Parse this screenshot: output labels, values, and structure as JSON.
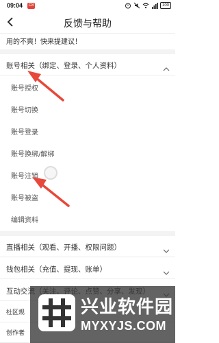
{
  "status_bar": {
    "time": "09:04",
    "badge": "C8",
    "battery": "100"
  },
  "nav": {
    "title": "反馈与帮助"
  },
  "partial_top": {
    "text": "用的不爽！快来提建议！"
  },
  "account_section": {
    "header": "账号相关（绑定、登录、个人资料）",
    "items": [
      "账号授权",
      "账号切换",
      "账号登录",
      "账号换绑/解绑",
      "账号注销",
      "账号被盗",
      "编辑资料"
    ]
  },
  "other_sections": [
    {
      "label": "直播相关（观看、开播、权限问题）"
    },
    {
      "label": "钱包相关（充值、提现、账单）"
    },
    {
      "label": "互动交流（关注、评论、点赞、分享、发现）"
    }
  ],
  "bottom_rows": [
    {
      "label": "社区规"
    },
    {
      "label": "创作者"
    }
  ],
  "watermark": {
    "title": "兴业软件园",
    "url": "MYXYJS.COM"
  },
  "colors": {
    "arrow": "#e8473b",
    "badge": "#e0443a"
  }
}
